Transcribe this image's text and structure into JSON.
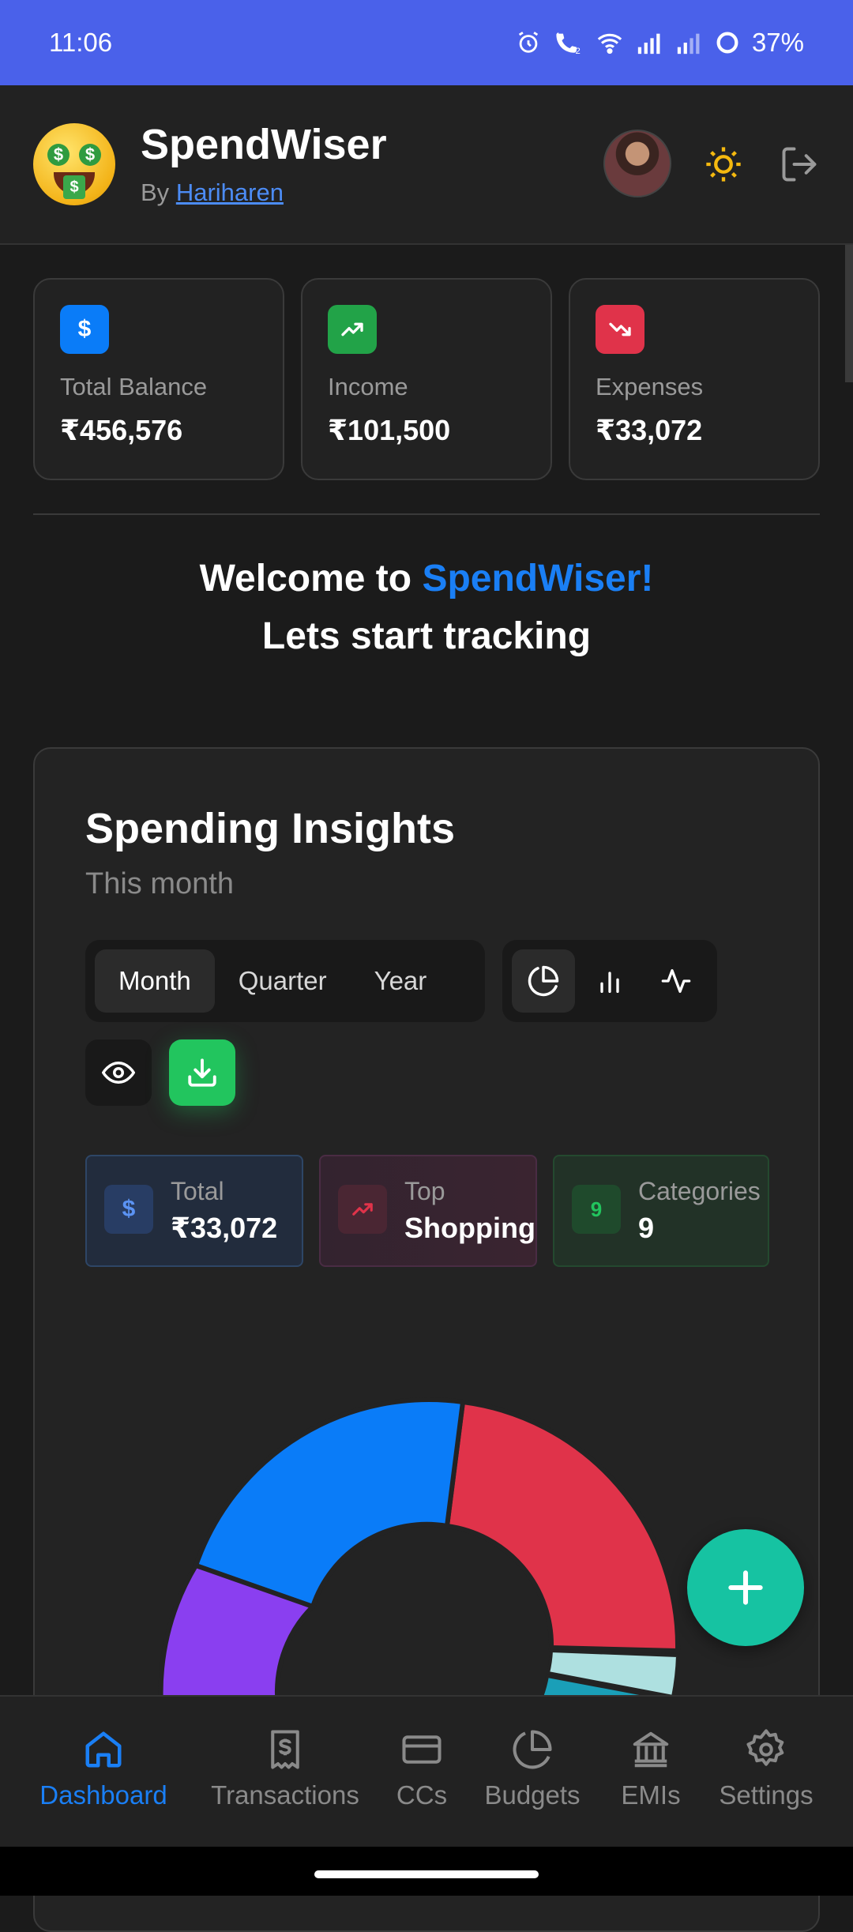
{
  "status_bar": {
    "time": "11:06",
    "battery": "37%"
  },
  "header": {
    "title": "SpendWiser",
    "by_prefix": "By",
    "author": "Hariharen"
  },
  "stats": [
    {
      "label": "Total Balance",
      "value": "₹456,576",
      "icon": "dollar-icon",
      "color": "#0a7cf8"
    },
    {
      "label": "Income",
      "value": "₹101,500",
      "icon": "trending-up-icon",
      "color": "#22a348"
    },
    {
      "label": "Expenses",
      "value": "₹33,072",
      "icon": "trending-down-icon",
      "color": "#e0334a"
    }
  ],
  "welcome": {
    "line1_prefix": "Welcome to",
    "line1_brand": "SpendWiser!",
    "line2": "Lets start tracking"
  },
  "insights": {
    "title": "Spending Insights",
    "subtitle": "This month",
    "periods": [
      "Month",
      "Quarter",
      "Year"
    ],
    "active_period": "Month",
    "chart_types": [
      "pie-chart-icon",
      "bar-chart-icon",
      "line-chart-icon"
    ],
    "active_chart": "pie-chart-icon",
    "summary": [
      {
        "label": "Total",
        "value": "₹33,072",
        "icon": "dollar-icon",
        "color": "#4c8cf5"
      },
      {
        "label": "Top",
        "value": "Shopping",
        "icon": "trending-up-icon",
        "color": "#e0334a"
      },
      {
        "label": "Categories",
        "value": "9",
        "icon_text": "9",
        "color": "#22c55e"
      }
    ]
  },
  "donut_colors": [
    "#0a7cf8",
    "#e0334a",
    "#aee0e0",
    "#1a9fb8",
    "#8a3ff0"
  ],
  "nav": [
    {
      "label": "Dashboard",
      "icon": "home-icon",
      "active": true
    },
    {
      "label": "Transactions",
      "icon": "receipt-icon",
      "active": false
    },
    {
      "label": "CCs",
      "icon": "credit-card-icon",
      "active": false
    },
    {
      "label": "Budgets",
      "icon": "pie-chart-icon",
      "active": false
    },
    {
      "label": "EMIs",
      "icon": "bank-icon",
      "active": false
    },
    {
      "label": "Settings",
      "icon": "gear-icon",
      "active": false
    }
  ]
}
